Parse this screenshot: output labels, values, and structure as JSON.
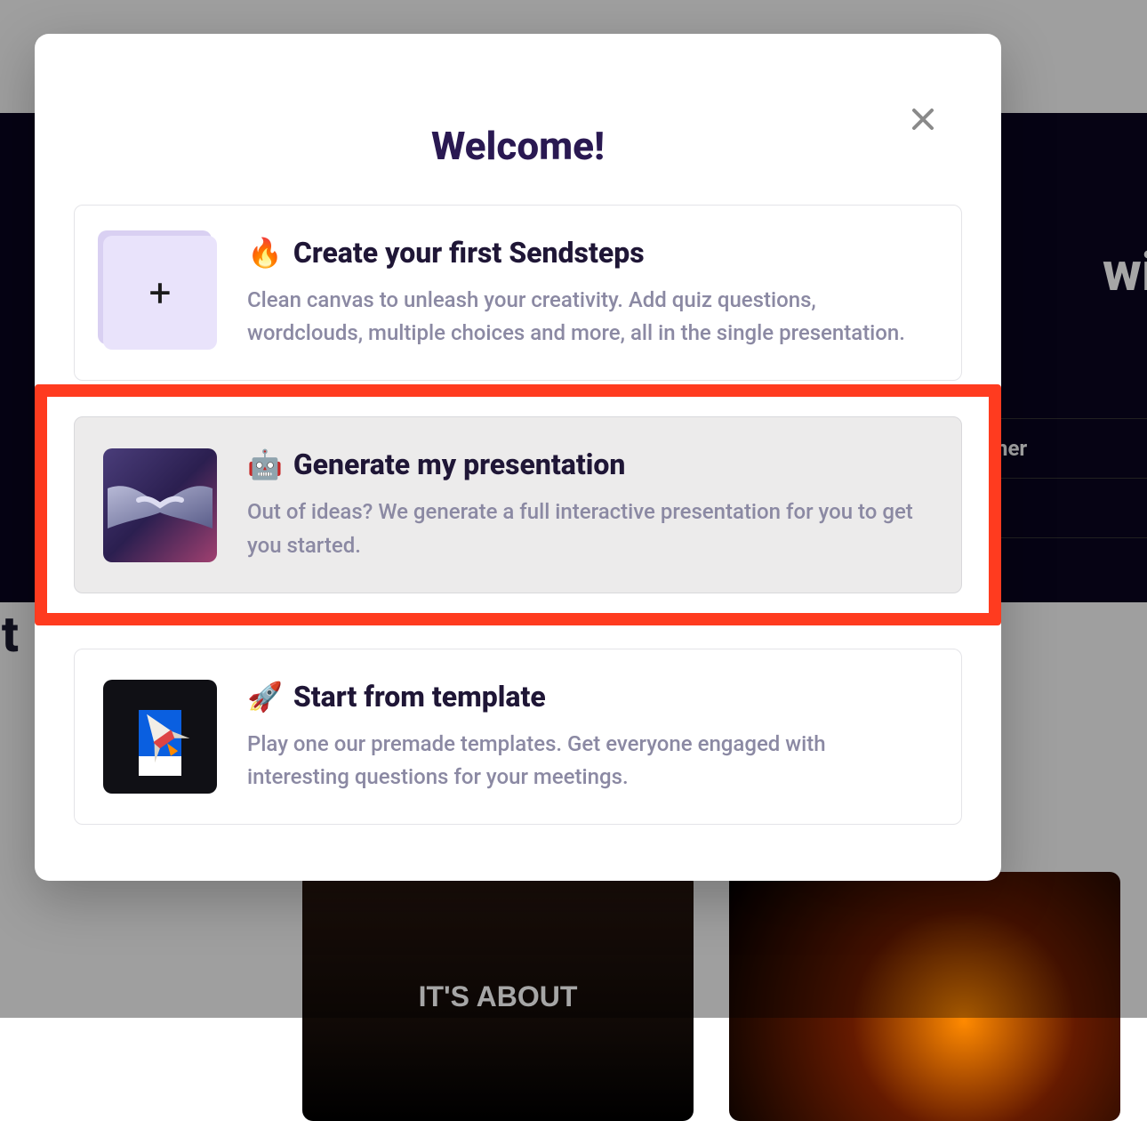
{
  "background": {
    "hero_text_right": "wi",
    "hero_text_left": "Vit",
    "side_tab": "her",
    "template_card_text": "IT'S ABOUT"
  },
  "modal": {
    "title": "Welcome!",
    "close_icon": "close",
    "options": [
      {
        "emoji": "🔥",
        "title": "Create your first Sendsteps",
        "description": "Clean canvas to unleash your creativity. Add quiz questions, wordclouds, multiple choices and more, all in the single presentation.",
        "highlighted": false
      },
      {
        "emoji": "🤖",
        "title": "Generate my presentation",
        "description": "Out of ideas? We generate a full interactive presentation for you to get you started.",
        "highlighted": true
      },
      {
        "emoji": "🚀",
        "title": "Start from template",
        "description": "Play one our premade templates. Get everyone engaged with interesting questions for your meetings.",
        "highlighted": false
      }
    ]
  }
}
